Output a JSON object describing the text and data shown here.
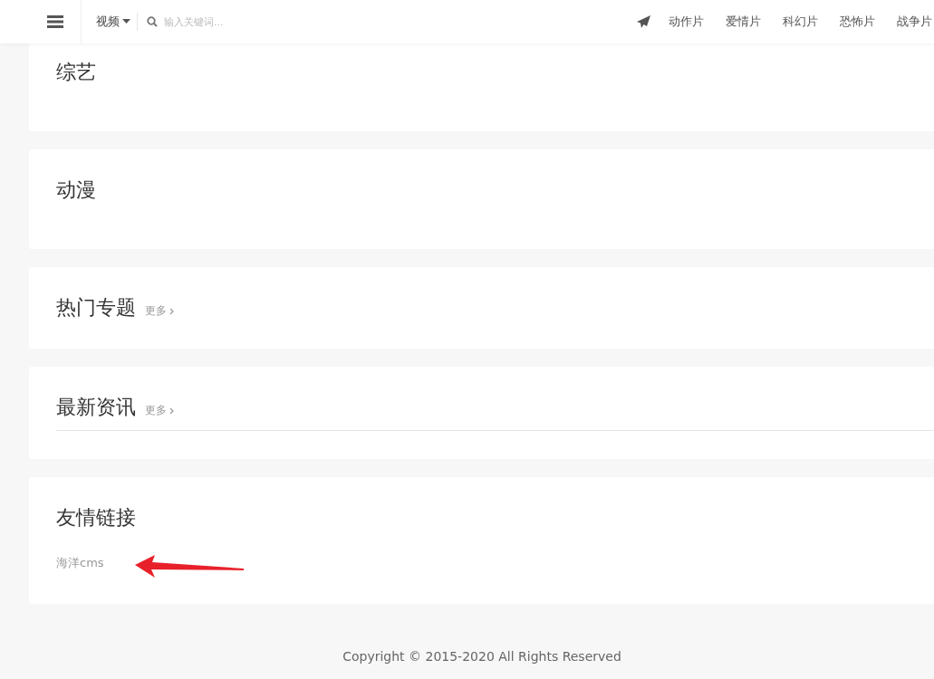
{
  "header": {
    "channel": "视频",
    "search": {
      "placeholder": "输入关键词..."
    },
    "nav": [
      "动作片",
      "爱情片",
      "科幻片",
      "恐怖片",
      "战争片"
    ]
  },
  "sections": [
    {
      "title": "综艺",
      "ruled": false
    },
    {
      "title": "动漫",
      "ruled": false
    },
    {
      "title": "热门专题",
      "more": "更多",
      "ruled": false
    },
    {
      "title": "最新资讯",
      "more": "更多",
      "ruled": true
    },
    {
      "title": "友情链接",
      "ruled": false,
      "links": [
        "海洋cms"
      ],
      "annotated": true
    }
  ],
  "footer": "Copyright © 2015-2020 All Rights Reserved"
}
